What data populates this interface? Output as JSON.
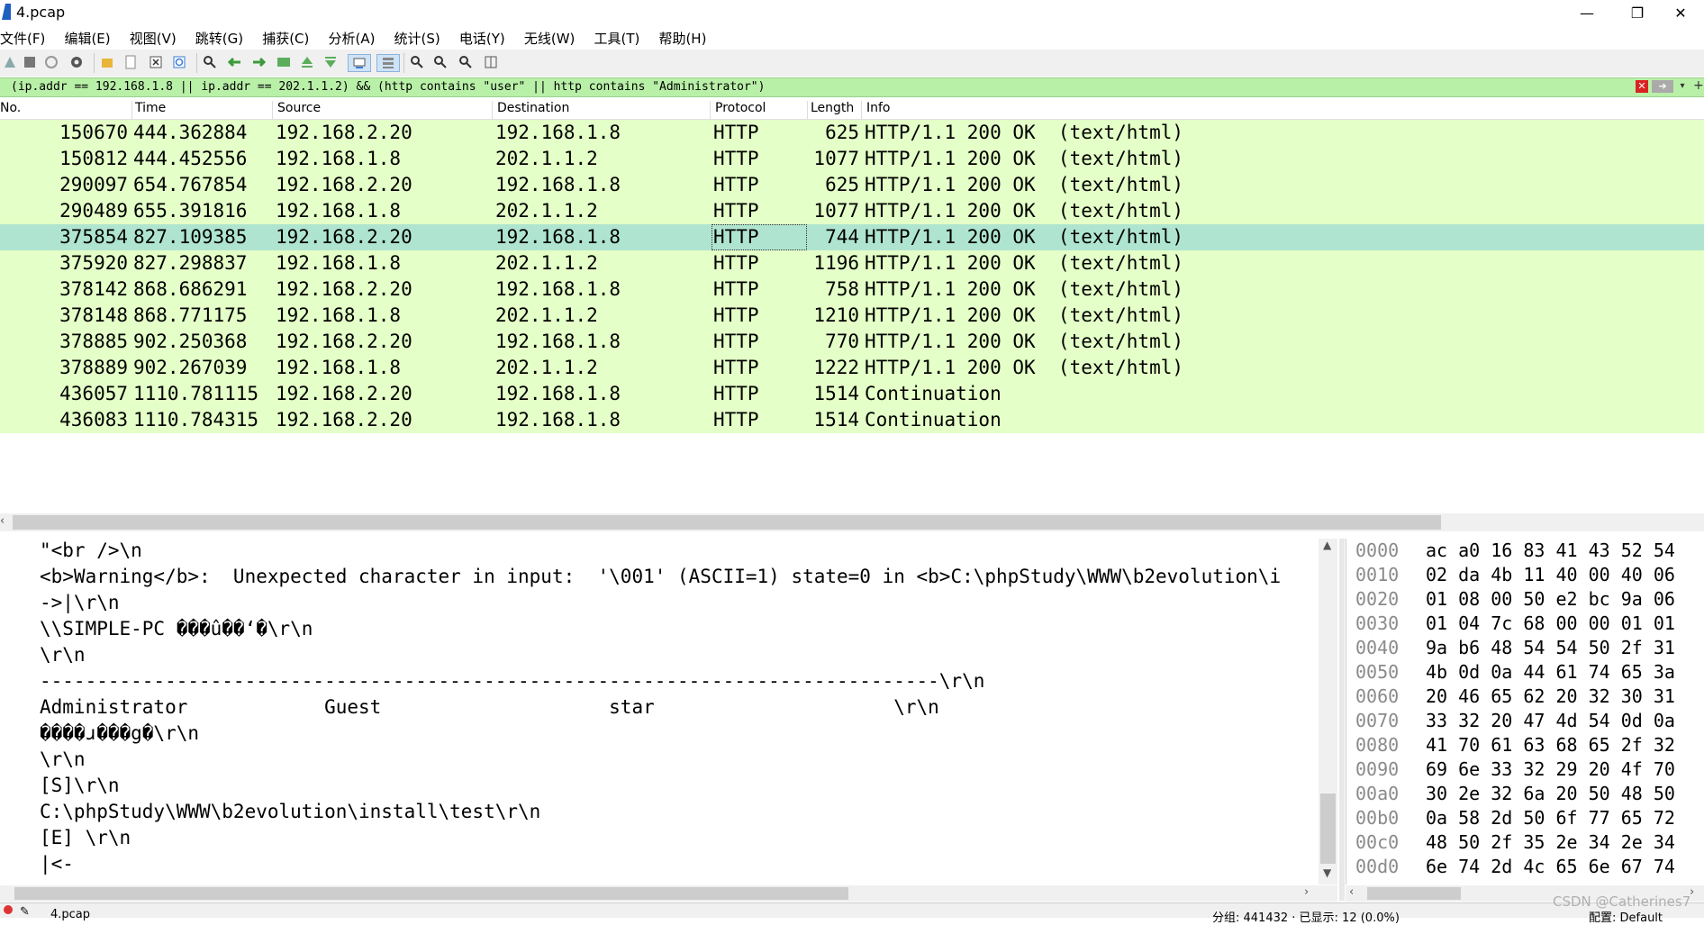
{
  "window": {
    "title": "4.pcap",
    "minimize_glyph": "—",
    "maximize_glyph": "❐",
    "close_glyph": "✕"
  },
  "menu": [
    "文件(F)",
    "编辑(E)",
    "视图(V)",
    "跳转(G)",
    "捕获(C)",
    "分析(A)",
    "统计(S)",
    "电话(Y)",
    "无线(W)",
    "工具(T)",
    "帮助(H)"
  ],
  "toolbar_icons": [
    "shark-fin-start-icon",
    "stop-icon",
    "restart-icon",
    "options-gear-icon",
    "open-folder-icon",
    "file-icon",
    "close-file-icon",
    "reload-icon",
    "find-icon",
    "back-arrow-icon",
    "forward-arrow-icon",
    "goto-packet-icon",
    "first-packet-icon",
    "last-packet-icon",
    "autoscroll-icon",
    "colorize-icon",
    "zoom-in-icon",
    "zoom-out-icon",
    "zoom-normal-icon",
    "resize-columns-icon"
  ],
  "filter": {
    "value": "(ip.addr == 192.168.1.8 || ip.addr == 202.1.1.2) && (http contains \"user\" || http contains \"Administrator\")",
    "clear_glyph": "✕",
    "apply_glyph": "➔",
    "dropdown_glyph": "▾",
    "add_glyph": "+"
  },
  "columns": {
    "no": "No.",
    "time": "Time",
    "source": "Source",
    "destination": "Destination",
    "protocol": "Protocol",
    "length": "Length",
    "info": "Info"
  },
  "packets": [
    {
      "no": "150670",
      "time": "444.362884",
      "src": "192.168.2.20",
      "dst": "192.168.1.8",
      "proto": "HTTP",
      "len": "625",
      "info": "HTTP/1.1 200 OK  (text/html)"
    },
    {
      "no": "150812",
      "time": "444.452556",
      "src": "192.168.1.8",
      "dst": "202.1.1.2",
      "proto": "HTTP",
      "len": "1077",
      "info": "HTTP/1.1 200 OK  (text/html)"
    },
    {
      "no": "290097",
      "time": "654.767854",
      "src": "192.168.2.20",
      "dst": "192.168.1.8",
      "proto": "HTTP",
      "len": "625",
      "info": "HTTP/1.1 200 OK  (text/html)"
    },
    {
      "no": "290489",
      "time": "655.391816",
      "src": "192.168.1.8",
      "dst": "202.1.1.2",
      "proto": "HTTP",
      "len": "1077",
      "info": "HTTP/1.1 200 OK  (text/html)"
    },
    {
      "no": "375854",
      "time": "827.109385",
      "src": "192.168.2.20",
      "dst": "192.168.1.8",
      "proto": "HTTP",
      "len": "744",
      "info": "HTTP/1.1 200 OK  (text/html)",
      "selected": true
    },
    {
      "no": "375920",
      "time": "827.298837",
      "src": "192.168.1.8",
      "dst": "202.1.1.2",
      "proto": "HTTP",
      "len": "1196",
      "info": "HTTP/1.1 200 OK  (text/html)"
    },
    {
      "no": "378142",
      "time": "868.686291",
      "src": "192.168.2.20",
      "dst": "192.168.1.8",
      "proto": "HTTP",
      "len": "758",
      "info": "HTTP/1.1 200 OK  (text/html)"
    },
    {
      "no": "378148",
      "time": "868.771175",
      "src": "192.168.1.8",
      "dst": "202.1.1.2",
      "proto": "HTTP",
      "len": "1210",
      "info": "HTTP/1.1 200 OK  (text/html)"
    },
    {
      "no": "378885",
      "time": "902.250368",
      "src": "192.168.2.20",
      "dst": "192.168.1.8",
      "proto": "HTTP",
      "len": "770",
      "info": "HTTP/1.1 200 OK  (text/html)"
    },
    {
      "no": "378889",
      "time": "902.267039",
      "src": "192.168.1.8",
      "dst": "202.1.1.2",
      "proto": "HTTP",
      "len": "1222",
      "info": "HTTP/1.1 200 OK  (text/html)"
    },
    {
      "no": "436057",
      "time": "1110.781115",
      "src": "192.168.2.20",
      "dst": "192.168.1.8",
      "proto": "HTTP",
      "len": "1514",
      "info": "Continuation"
    },
    {
      "no": "436083",
      "time": "1110.784315",
      "src": "192.168.2.20",
      "dst": "192.168.1.8",
      "proto": "HTTP",
      "len": "1514",
      "info": "Continuation"
    }
  ],
  "text_lines": [
    "\"<br />\\n",
    "<b>Warning</b>:  Unexpected character in input:  '\\001' (ASCII=1) state=0 in <b>C:\\phpStudy\\WWW\\b2evolution\\i",
    "->|\\r\\n",
    "\\\\SIMPLE-PC ���û��ʻ�\\r\\n",
    "\\r\\n",
    "-------------------------------------------------------------------------------\\r\\n",
    "Administrator            Guest                    star                     \\r\\n",
    "����ɹ���g�\\r\\n",
    "\\r\\n",
    "[S]\\r\\n",
    "C:\\phpStudy\\WWW\\b2evolution\\install\\test\\r\\n",
    "[E] \\r\\n",
    "|<-"
  ],
  "hex_rows": [
    {
      "off": "0000",
      "bytes": "ac a0 16 83 41 43 52 54"
    },
    {
      "off": "0010",
      "bytes": "02 da 4b 11 40 00 40 06"
    },
    {
      "off": "0020",
      "bytes": "01 08 00 50 e2 bc 9a 06"
    },
    {
      "off": "0030",
      "bytes": "01 04 7c 68 00 00 01 01"
    },
    {
      "off": "0040",
      "bytes": "9a b6 48 54 54 50 2f 31"
    },
    {
      "off": "0050",
      "bytes": "4b 0d 0a 44 61 74 65 3a"
    },
    {
      "off": "0060",
      "bytes": "20 46 65 62 20 32 30 31"
    },
    {
      "off": "0070",
      "bytes": "33 32 20 47 4d 54 0d 0a"
    },
    {
      "off": "0080",
      "bytes": "41 70 61 63 68 65 2f 32"
    },
    {
      "off": "0090",
      "bytes": "69 6e 33 32 29 20 4f 70"
    },
    {
      "off": "00a0",
      "bytes": "30 2e 32 6a 20 50 48 50"
    },
    {
      "off": "00b0",
      "bytes": "0a 58 2d 50 6f 77 65 72"
    },
    {
      "off": "00c0",
      "bytes": "48 50 2f 35 2e 34 2e 34"
    },
    {
      "off": "00d0",
      "bytes": "6e 74 2d 4c 65 6e 67 74"
    }
  ],
  "status": {
    "file": "4.pcap",
    "packets": "分组: 441432 · 已显示: 12 (0.0%)",
    "profile": "配置: Default"
  },
  "watermark": "CSDN @Catherines7"
}
